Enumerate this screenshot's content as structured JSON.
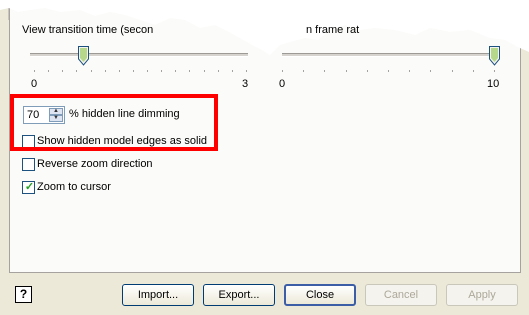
{
  "transition": {
    "label": "View transition time (secon",
    "min": "0",
    "max": "3",
    "value_seconds": 0.7
  },
  "framerate": {
    "label": "n frame rat",
    "min": "0",
    "max": "10",
    "value": 10
  },
  "dimming": {
    "value": "70",
    "label": "% hidden line dimming"
  },
  "options": {
    "solid_edges": {
      "label": "Show hidden model edges as solid",
      "checked": false
    },
    "reverse_zoom": {
      "label": "Reverse zoom direction",
      "checked": false
    },
    "zoom_to_cursor": {
      "label": "Zoom to cursor",
      "checked": true
    }
  },
  "buttons": {
    "help_icon": "?",
    "import": "Import...",
    "export": "Export...",
    "close": "Close",
    "cancel": "Cancel",
    "apply": "Apply"
  },
  "colors": {
    "highlight": "#ff0000",
    "checkmark": "#21a121"
  },
  "icons": {
    "help": "help-icon",
    "spin_up": "spin-up-icon",
    "spin_down": "spin-down-icon"
  }
}
